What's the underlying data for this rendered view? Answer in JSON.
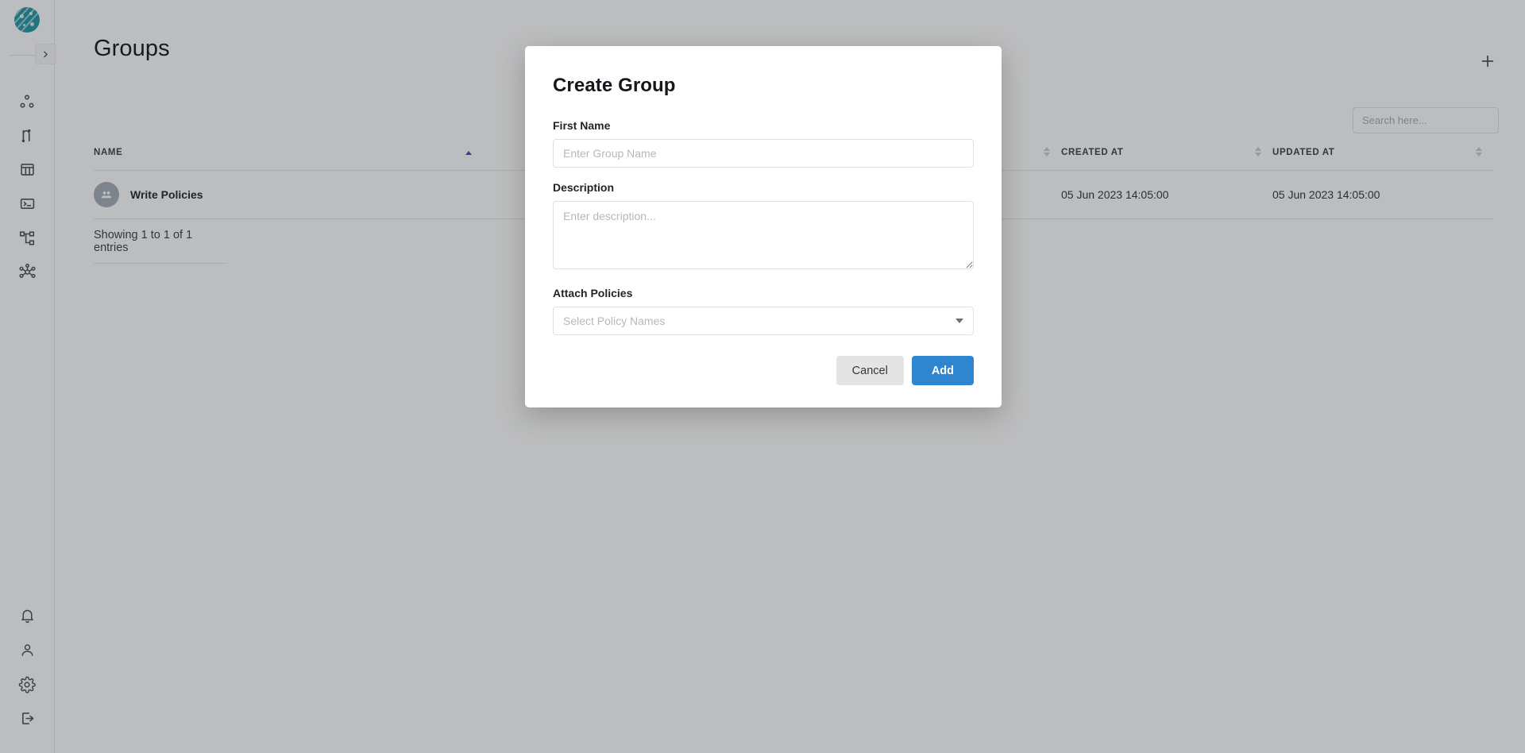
{
  "app": {
    "logo_icon": "circuit-globe-logo",
    "collapse_icon": "chevron-right-icon"
  },
  "sidebar": {
    "top_items": [
      {
        "icon": "cluster-nodes-icon",
        "name": "sidebar-item-clusters"
      },
      {
        "icon": "pipeline-route-icon",
        "name": "sidebar-item-pipelines"
      },
      {
        "icon": "table-columns-icon",
        "name": "sidebar-item-tables"
      },
      {
        "icon": "terminal-console-icon",
        "name": "sidebar-item-console"
      },
      {
        "icon": "sitemap-hierarchy-icon",
        "name": "sidebar-item-hierarchy"
      },
      {
        "icon": "network-hub-icon",
        "name": "sidebar-item-network"
      }
    ],
    "bottom_items": [
      {
        "icon": "bell-icon",
        "name": "sidebar-item-notifications"
      },
      {
        "icon": "user-icon",
        "name": "sidebar-item-profile"
      },
      {
        "icon": "gear-icon",
        "name": "sidebar-item-settings"
      },
      {
        "icon": "logout-icon",
        "name": "sidebar-item-logout"
      }
    ]
  },
  "header": {
    "title": "Groups",
    "add_icon": "plus-icon"
  },
  "search": {
    "placeholder": "Search here...",
    "value": "",
    "icon": "search-icon"
  },
  "table": {
    "columns": [
      {
        "label": "NAME",
        "sort": "asc"
      },
      {
        "label": "",
        "sort": "none"
      },
      {
        "label": "CREATED AT",
        "sort": "none"
      },
      {
        "label": "UPDATED AT",
        "sort": "none"
      }
    ],
    "rows": [
      {
        "avatar_icon": "group-users-icon",
        "name": "Write Policies",
        "hidden_col": "",
        "created_at": "05 Jun 2023 14:05:00",
        "updated_at": "05 Jun 2023 14:05:00"
      }
    ],
    "footer": "Showing 1 to 1 of 1 entries"
  },
  "modal": {
    "title": "Create Group",
    "fields": {
      "first_name": {
        "label": "First Name",
        "placeholder": "Enter Group Name",
        "value": ""
      },
      "description": {
        "label": "Description",
        "placeholder": "Enter description...",
        "value": ""
      },
      "attach_policies": {
        "label": "Attach Policies",
        "placeholder": "Select Policy Names",
        "value": "",
        "caret_icon": "chevron-down-icon"
      }
    },
    "cancel_label": "Cancel",
    "add_label": "Add"
  },
  "colors": {
    "brand_teal": "#2196a8",
    "primary_blue": "#2f86cf",
    "cancel_gray": "#e4e4e5",
    "sort_active": "#3d4da8",
    "avatar_gray": "#a7aeb6"
  }
}
